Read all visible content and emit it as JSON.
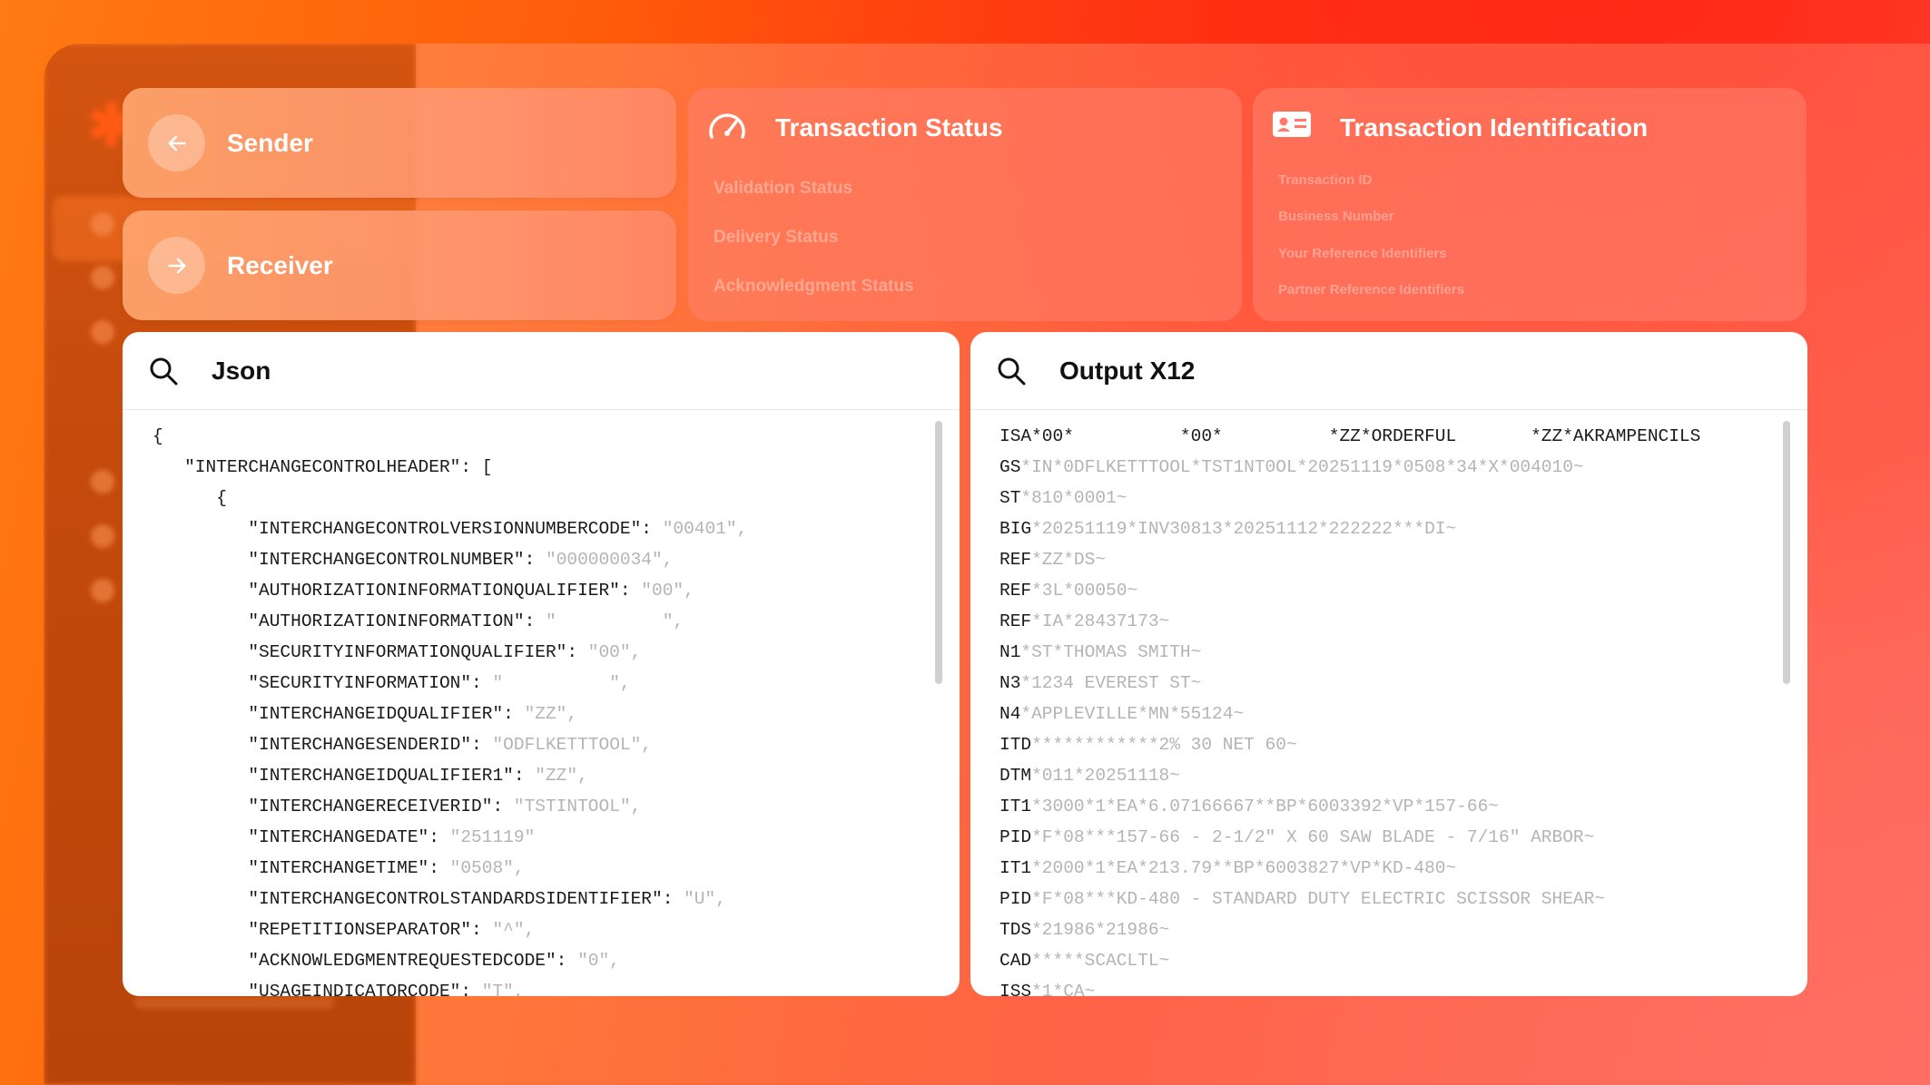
{
  "colors": {
    "accent": "#ff5a0a",
    "card_text": "#ffffff",
    "code_key": "#1a1a1a",
    "code_value": "#b4b4b4"
  },
  "sender_card": {
    "label": "Sender",
    "icon": "arrow-left-icon"
  },
  "receiver_card": {
    "label": "Receiver",
    "icon": "arrow-right-icon"
  },
  "transaction_status": {
    "title": "Transaction Status",
    "icon": "speedometer-icon",
    "fields": [
      "Validation Status",
      "Delivery Status",
      "Acknowledgment Status"
    ]
  },
  "transaction_identification": {
    "title": "Transaction Identification",
    "icon": "id-card-icon",
    "fields": [
      "Transaction ID",
      "Business Number",
      "Your Reference Identifiers",
      "Partner Reference Identifiers"
    ]
  },
  "json_panel": {
    "title": "Json",
    "lines": [
      {
        "k": "{",
        "v": ""
      },
      {
        "k": "   \"INTERCHANGECONTROLHEADER\": [",
        "v": ""
      },
      {
        "k": "      {",
        "v": ""
      },
      {
        "k": "         \"INTERCHANGECONTROLVERSIONNUMBERCODE\": ",
        "v": "\"00401\","
      },
      {
        "k": "         \"INTERCHANGECONTROLNUMBER\": ",
        "v": "\"000000034\","
      },
      {
        "k": "         \"AUTHORIZATIONINFORMATIONQUALIFIER\": ",
        "v": "\"00\","
      },
      {
        "k": "         \"AUTHORIZATIONINFORMATION\": ",
        "v": "\"          \","
      },
      {
        "k": "         \"SECURITYINFORMATIONQUALIFIER\": ",
        "v": "\"00\","
      },
      {
        "k": "         \"SECURITYINFORMATION\": ",
        "v": "\"          \","
      },
      {
        "k": "         \"INTERCHANGEIDQUALIFIER\": ",
        "v": "\"ZZ\","
      },
      {
        "k": "         \"INTERCHANGESENDERID\": ",
        "v": "\"ODFLKETTTOOL\","
      },
      {
        "k": "         \"INTERCHANGEIDQUALIFIER1\": ",
        "v": "\"ZZ\","
      },
      {
        "k": "         \"INTERCHANGERECEIVERID\": ",
        "v": "\"TSTINTOOL\","
      },
      {
        "k": "         \"INTERCHANGEDATE\": ",
        "v": "\"251119\""
      },
      {
        "k": "         \"INTERCHANGETIME\": ",
        "v": "\"0508\","
      },
      {
        "k": "         \"INTERCHANGECONTROLSTANDARDSIDENTIFIER\": ",
        "v": "\"U\","
      },
      {
        "k": "         \"REPETITIONSEPARATOR\": ",
        "v": "\"^\","
      },
      {
        "k": "         \"ACKNOWLEDGMENTREQUESTEDCODE\": ",
        "v": "\"0\","
      },
      {
        "k": "         \"USAGEINDICATORCODE\": ",
        "v": "\"T\","
      }
    ]
  },
  "x12_panel": {
    "title": "Output X12",
    "lines": [
      {
        "k": "ISA*00*          *00*          *ZZ*ORDERFUL       *ZZ*AKRAMPENCILS",
        "v": ""
      },
      {
        "k": "GS",
        "v": "*IN*0DFLKETTTOOL*TST1NT0OL*20251119*0508*34*X*004010~"
      },
      {
        "k": "ST",
        "v": "*810*0001~"
      },
      {
        "k": "BIG",
        "v": "*20251119*INV30813*20251112*222222***DI~"
      },
      {
        "k": "REF",
        "v": "*ZZ*DS~"
      },
      {
        "k": "REF",
        "v": "*3L*00050~"
      },
      {
        "k": "REF",
        "v": "*IA*28437173~"
      },
      {
        "k": "N1",
        "v": "*ST*THOMAS SMITH~"
      },
      {
        "k": "N3",
        "v": "*1234 EVEREST ST~"
      },
      {
        "k": "N4",
        "v": "*APPLEVILLE*MN*55124~"
      },
      {
        "k": "ITD",
        "v": "************2% 30 NET 60~"
      },
      {
        "k": "DTM",
        "v": "*011*20251118~"
      },
      {
        "k": "IT1",
        "v": "*3000*1*EA*6.07166667**BP*6003392*VP*157-66~"
      },
      {
        "k": "PID",
        "v": "*F*08***157-66 - 2-1/2\" X 60 SAW BLADE - 7/16\" ARBOR~"
      },
      {
        "k": "IT1",
        "v": "*2000*1*EA*213.79**BP*6003827*VP*KD-480~"
      },
      {
        "k": "PID",
        "v": "*F*08***KD-480 - STANDARD DUTY ELECTRIC SCISSOR SHEAR~"
      },
      {
        "k": "TDS",
        "v": "*21986*21986~"
      },
      {
        "k": "CAD",
        "v": "*****SCACLTL~"
      },
      {
        "k": "ISS",
        "v": "*1*CA~"
      }
    ]
  }
}
